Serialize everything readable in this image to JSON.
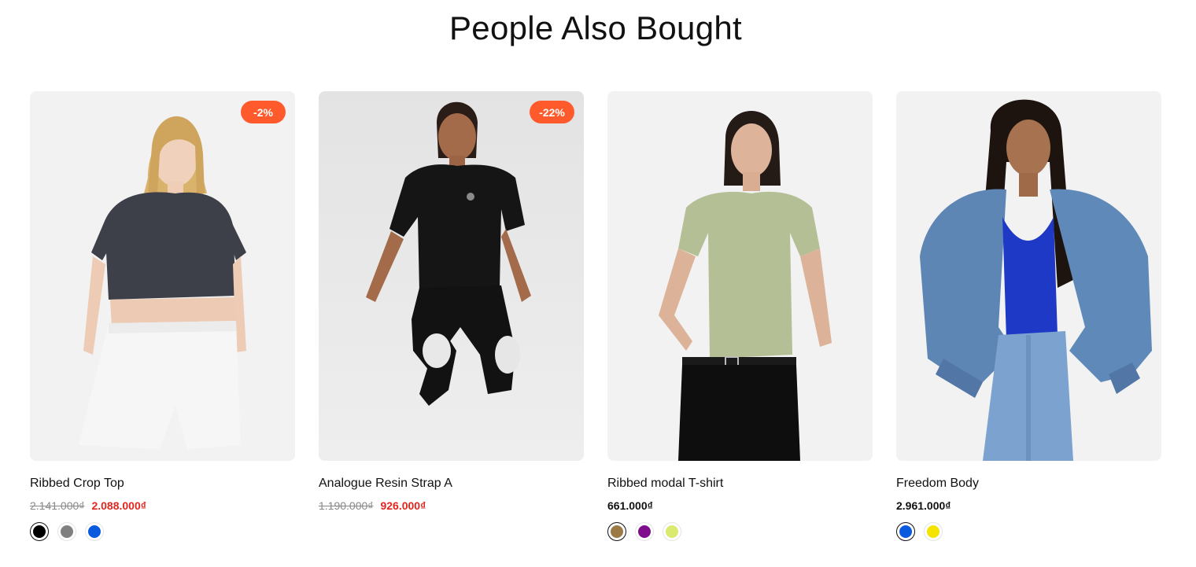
{
  "section": {
    "title": "People Also Bought"
  },
  "products": [
    {
      "name": "Ribbed Crop Top",
      "badge": "-2%",
      "old_price": "2.141.000₫",
      "price": "2.088.000₫",
      "on_sale": true,
      "swatches": [
        {
          "color": "#000000",
          "selected": true
        },
        {
          "color": "#808080",
          "selected": false
        },
        {
          "color": "#0a5ae0",
          "selected": false
        }
      ]
    },
    {
      "name": "Analogue Resin Strap A",
      "badge": "-22%",
      "old_price": "1.190.000₫",
      "price": "926.000₫",
      "on_sale": true,
      "swatches": []
    },
    {
      "name": "Ribbed modal T-shirt",
      "badge": "",
      "old_price": "",
      "price": "661.000₫",
      "on_sale": false,
      "swatches": [
        {
          "color": "#9b7a45",
          "selected": true
        },
        {
          "color": "#7e0e8c",
          "selected": false
        },
        {
          "color": "#d9ea6e",
          "selected": false
        }
      ]
    },
    {
      "name": "Freedom Body",
      "badge": "",
      "old_price": "",
      "price": "2.961.000₫",
      "on_sale": false,
      "swatches": [
        {
          "color": "#0a5ae0",
          "selected": true
        },
        {
          "color": "#f5e400",
          "selected": false
        }
      ]
    }
  ],
  "colors": {
    "badge_bg": "#ff5a2c",
    "sale_price": "#e0261f",
    "card_bg": "#f2f2f2"
  }
}
